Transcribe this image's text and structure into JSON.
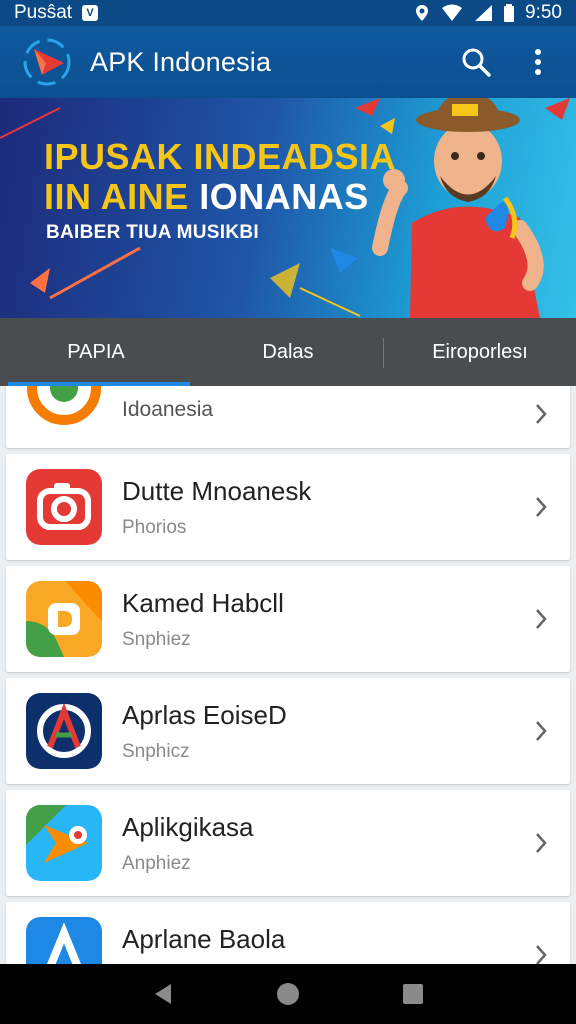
{
  "status_bar": {
    "left_text": "Pusŝat",
    "badge": "V",
    "time": "9:50"
  },
  "app_bar": {
    "title": "APK Indonesia",
    "actions": [
      "search-icon",
      "more-vert-icon"
    ]
  },
  "banner": {
    "line1": "IPUSAK INDEADSIA",
    "line2_part1": "IIN AINE",
    "line2_part2": "IONANAS",
    "subtitle": "BAIBER TIUA MUSIKBI"
  },
  "tabs": [
    {
      "label": "PAPIA",
      "active": true
    },
    {
      "label": "Dalas",
      "active": false
    },
    {
      "label": "Eiroporlesı",
      "active": false
    }
  ],
  "apps": [
    {
      "name": "",
      "category": "Idoanesia",
      "icon": "orange-circle-icon"
    },
    {
      "name": "Dutte Mnoanesk",
      "category": "Phorios",
      "icon": "camera-icon"
    },
    {
      "name": "Kamed Habcll",
      "category": "Snphiez",
      "icon": "d-letter-icon"
    },
    {
      "name": "Aprlas EoiseD",
      "category": "Snphicz",
      "icon": "a-triangle-icon"
    },
    {
      "name": "Aplikgikasa",
      "category": "Anphiez",
      "icon": "play-arrow-icon"
    },
    {
      "name": "Aprlane Baola",
      "category": "",
      "icon": "a-logo-icon"
    }
  ],
  "colors": {
    "primary": "#0f5a9e",
    "accent": "#1e88e5",
    "tab_bg": "#4a4d50",
    "banner_yellow": "#f5c518"
  }
}
